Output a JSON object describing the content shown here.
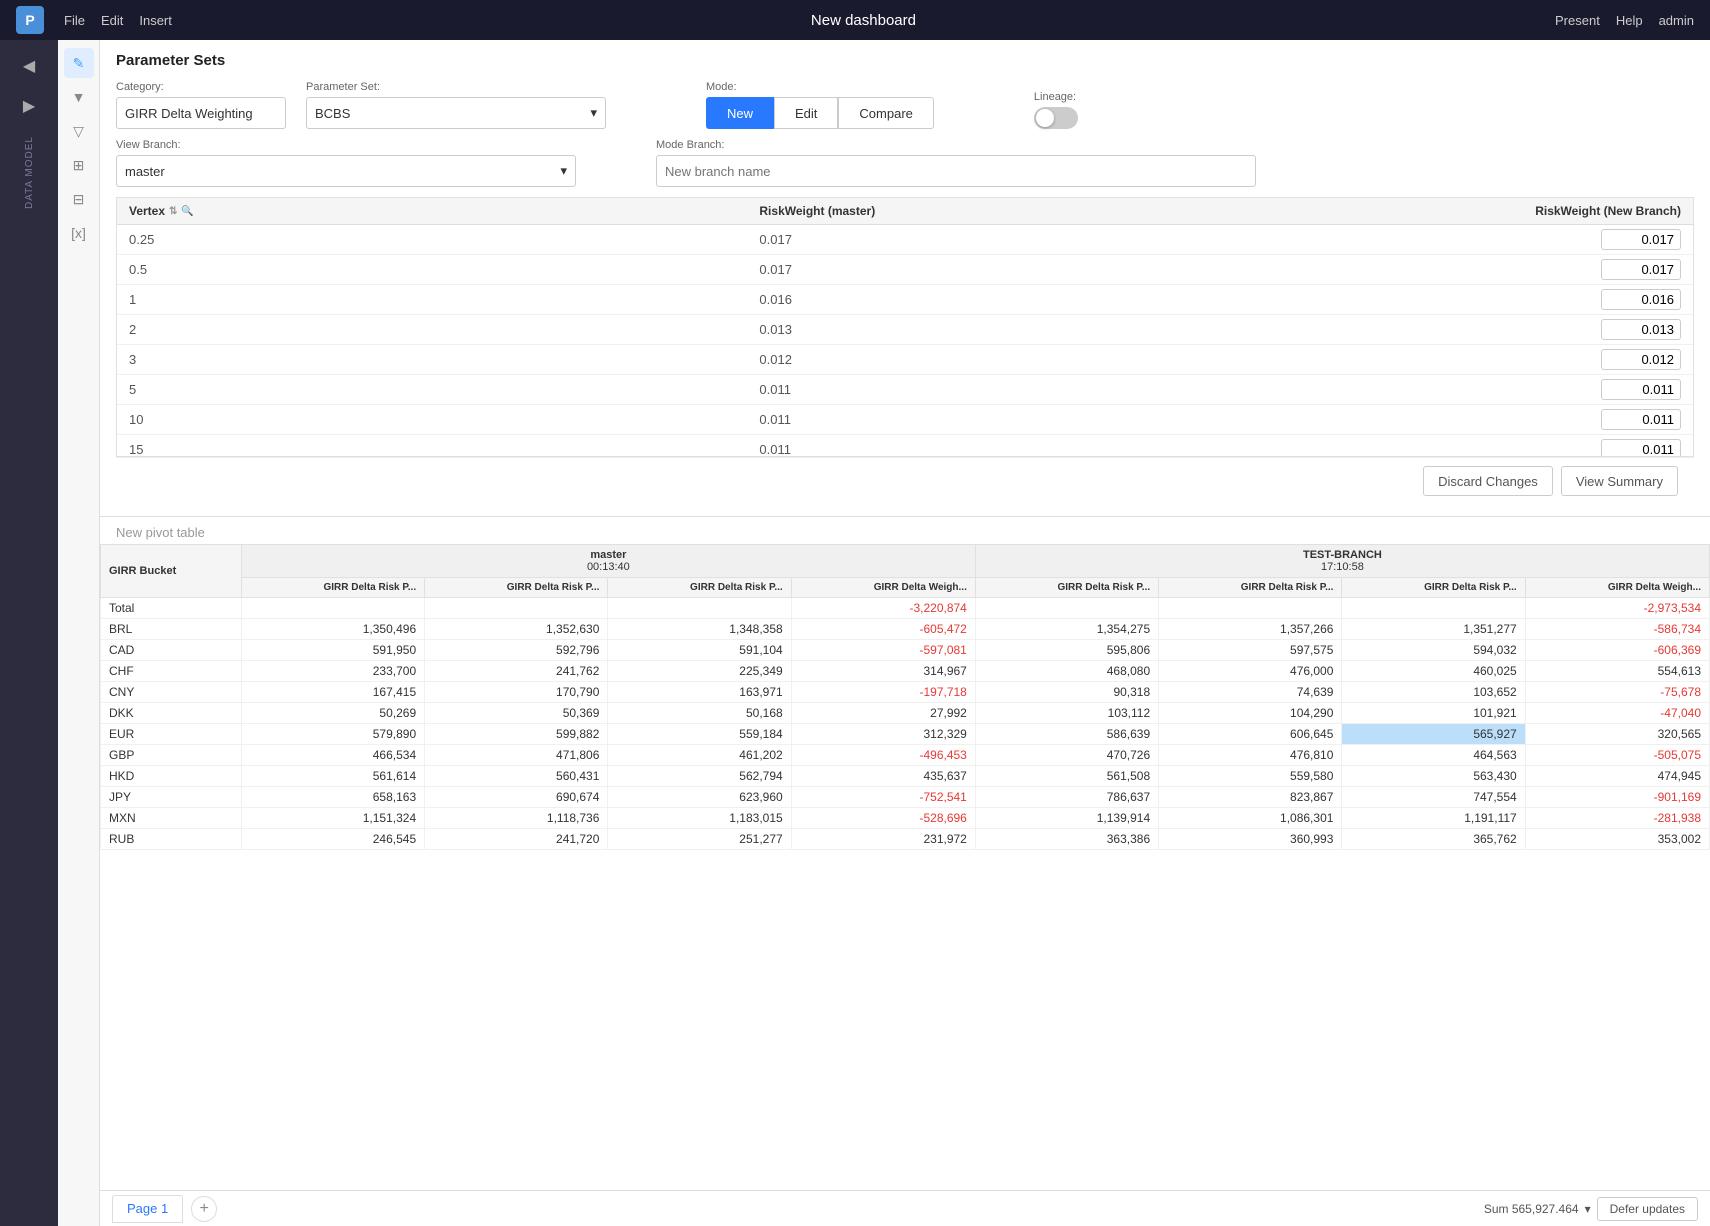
{
  "topbar": {
    "logo": "P",
    "menus": [
      "File",
      "Edit",
      "Insert"
    ],
    "title": "New dashboard",
    "actions": [
      "Present",
      "Help",
      "admin"
    ]
  },
  "sidebar": {
    "icons": [
      "◀",
      "▶"
    ],
    "label": "DATA MODEL",
    "tools": [
      "✏️",
      "▼",
      "▽",
      "⊞",
      "⊡",
      "[x]"
    ]
  },
  "param_sets": {
    "title": "Parameter Sets",
    "category_label": "Category:",
    "category_value": "GIRR Delta Weighting",
    "param_set_label": "Parameter Set:",
    "param_set_value": "BCBS",
    "mode_label": "Mode:",
    "mode_options": [
      "New",
      "Edit",
      "Compare"
    ],
    "mode_active": "New",
    "lineage_label": "Lineage:",
    "view_branch_label": "View Branch:",
    "view_branch_value": "master",
    "mode_branch_label": "Mode Branch:",
    "mode_branch_placeholder": "New branch name",
    "table": {
      "col_vertex": "Vertex",
      "col_master": "RiskWeight (master)",
      "col_new_branch": "RiskWeight (New Branch)",
      "rows": [
        {
          "vertex": "0.25",
          "master": "0.017",
          "new_branch": "0.017"
        },
        {
          "vertex": "0.5",
          "master": "0.017",
          "new_branch": "0.017"
        },
        {
          "vertex": "1",
          "master": "0.016",
          "new_branch": "0.016"
        },
        {
          "vertex": "2",
          "master": "0.013",
          "new_branch": "0.013"
        },
        {
          "vertex": "3",
          "master": "0.012",
          "new_branch": "0.012"
        },
        {
          "vertex": "5",
          "master": "0.011",
          "new_branch": "0.011"
        },
        {
          "vertex": "10",
          "master": "0.011",
          "new_branch": "0.011"
        },
        {
          "vertex": "15",
          "master": "0.011",
          "new_branch": "0.011"
        }
      ]
    },
    "discard_btn": "Discard Changes",
    "view_summary_btn": "View Summary"
  },
  "pivot": {
    "title": "New pivot table",
    "col_girr_bucket": "GIRR Bucket",
    "master_label": "master",
    "master_time": "00:13:40",
    "testbranch_label": "TEST-BRANCH",
    "testbranch_time": "17:10:58",
    "columns": [
      "GIRR Delta Risk P...",
      "GIRR Delta Risk P...",
      "GIRR Delta Risk P...",
      "GIRR Delta Weigh...",
      "GIRR Delta Risk P...",
      "GIRR Delta Risk P...",
      "GIRR Delta Risk P...",
      "GIRR Delta Weigh..."
    ],
    "rows": [
      {
        "label": "Total",
        "v1": "",
        "v2": "",
        "v3": "",
        "v4": "-3,220,874",
        "v5": "",
        "v6": "",
        "v7": "",
        "v8": "-2,973,534",
        "neg4": true,
        "neg8": true
      },
      {
        "label": "BRL",
        "v1": "1,350,496",
        "v2": "1,352,630",
        "v3": "1,348,358",
        "v4": "-605,472",
        "v5": "1,354,275",
        "v6": "1,357,266",
        "v7": "1,351,277",
        "v8": "-586,734",
        "neg4": true,
        "neg8": true
      },
      {
        "label": "CAD",
        "v1": "591,950",
        "v2": "592,796",
        "v3": "591,104",
        "v4": "-597,081",
        "v5": "595,806",
        "v6": "597,575",
        "v7": "594,032",
        "v8": "-606,369",
        "neg4": true,
        "neg8": true
      },
      {
        "label": "CHF",
        "v1": "233,700",
        "v2": "241,762",
        "v3": "225,349",
        "v4": "314,967",
        "v5": "468,080",
        "v6": "476,000",
        "v7": "460,025",
        "v8": "554,613",
        "neg4": false,
        "neg8": false
      },
      {
        "label": "CNY",
        "v1": "167,415",
        "v2": "170,790",
        "v3": "163,971",
        "v4": "-197,718",
        "v5": "90,318",
        "v6": "74,639",
        "v7": "103,652",
        "v8": "-75,678",
        "neg4": true,
        "neg8": true
      },
      {
        "label": "DKK",
        "v1": "50,269",
        "v2": "50,369",
        "v3": "50,168",
        "v4": "27,992",
        "v5": "103,112",
        "v6": "104,290",
        "v7": "101,921",
        "v8": "-47,040",
        "neg4": false,
        "neg8": true
      },
      {
        "label": "EUR",
        "v1": "579,890",
        "v2": "599,882",
        "v3": "559,184",
        "v4": "312,329",
        "v5": "586,639",
        "v6": "606,645",
        "v7": "565,927",
        "v8": "320,565",
        "neg4": false,
        "neg8": false,
        "hl7": true
      },
      {
        "label": "GBP",
        "v1": "466,534",
        "v2": "471,806",
        "v3": "461,202",
        "v4": "-496,453",
        "v5": "470,726",
        "v6": "476,810",
        "v7": "464,563",
        "v8": "-505,075",
        "neg4": true,
        "neg8": true
      },
      {
        "label": "HKD",
        "v1": "561,614",
        "v2": "560,431",
        "v3": "562,794",
        "v4": "435,637",
        "v5": "561,508",
        "v6": "559,580",
        "v7": "563,430",
        "v8": "474,945",
        "neg4": false,
        "neg8": false
      },
      {
        "label": "JPY",
        "v1": "658,163",
        "v2": "690,674",
        "v3": "623,960",
        "v4": "-752,541",
        "v5": "786,637",
        "v6": "823,867",
        "v7": "747,554",
        "v8": "-901,169",
        "neg4": true,
        "neg8": true
      },
      {
        "label": "MXN",
        "v1": "1,151,324",
        "v2": "1,118,736",
        "v3": "1,183,015",
        "v4": "-528,696",
        "v5": "1,139,914",
        "v6": "1,086,301",
        "v7": "1,191,117",
        "v8": "-281,938",
        "neg4": true,
        "neg8": true
      },
      {
        "label": "RUB",
        "v1": "246,545",
        "v2": "241,720",
        "v3": "251,277",
        "v4": "231,972",
        "v5": "363,386",
        "v6": "360,993",
        "v7": "365,762",
        "v8": "353,002",
        "neg4": false,
        "neg8": false
      }
    ],
    "sum_label": "Sum 565,927.464",
    "defer_btn": "Defer updates",
    "page_tab": "Page 1"
  }
}
